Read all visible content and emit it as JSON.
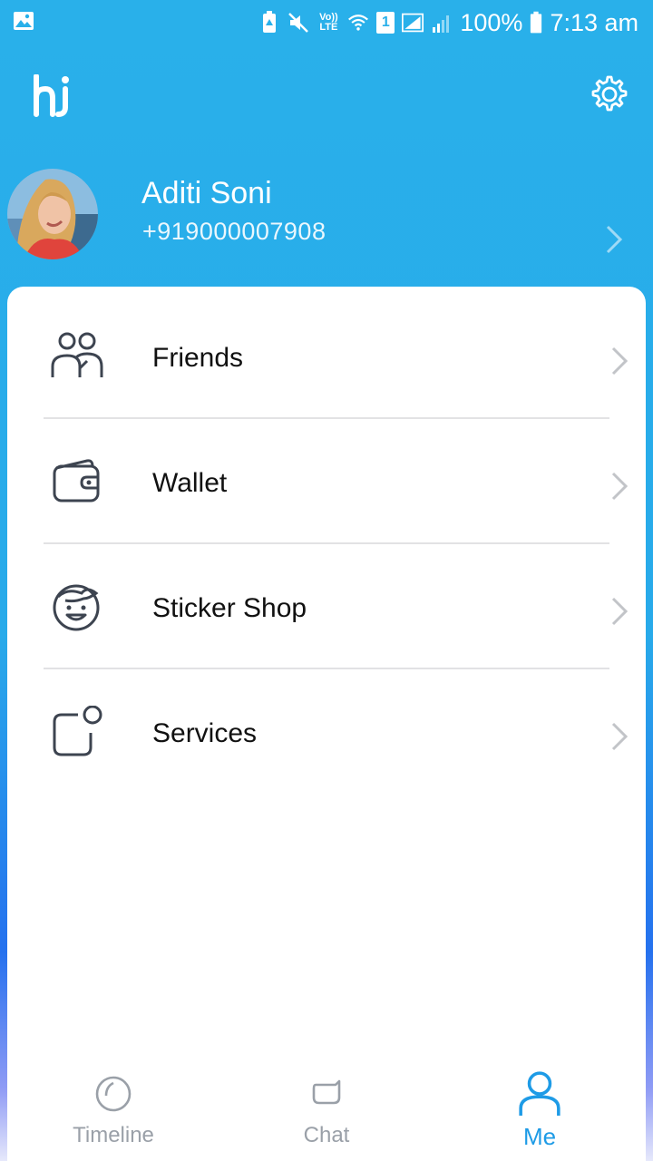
{
  "status_bar": {
    "battery": "100%",
    "time": "7:13 am",
    "sim_slot": "1",
    "volte": "Vo)) LTE"
  },
  "header": {
    "logo_text": "hi",
    "settings_icon": "gear-icon"
  },
  "profile": {
    "name": "Aditi Soni",
    "phone": "+919000007908"
  },
  "menu": {
    "items": [
      {
        "label": "Friends",
        "icon": "friends-icon"
      },
      {
        "label": "Wallet",
        "icon": "wallet-icon"
      },
      {
        "label": "Sticker Shop",
        "icon": "sticker-face-icon"
      },
      {
        "label": "Services",
        "icon": "services-icon"
      }
    ]
  },
  "bottom_nav": {
    "tabs": [
      {
        "label": "Timeline",
        "icon": "timeline-icon"
      },
      {
        "label": "Chat",
        "icon": "chat-icon"
      },
      {
        "label": "Me",
        "icon": "person-icon",
        "active": true
      }
    ]
  },
  "colors": {
    "accent": "#1e9be6",
    "header_bg": "#29b0ea",
    "icon_stroke": "#3d4450"
  }
}
